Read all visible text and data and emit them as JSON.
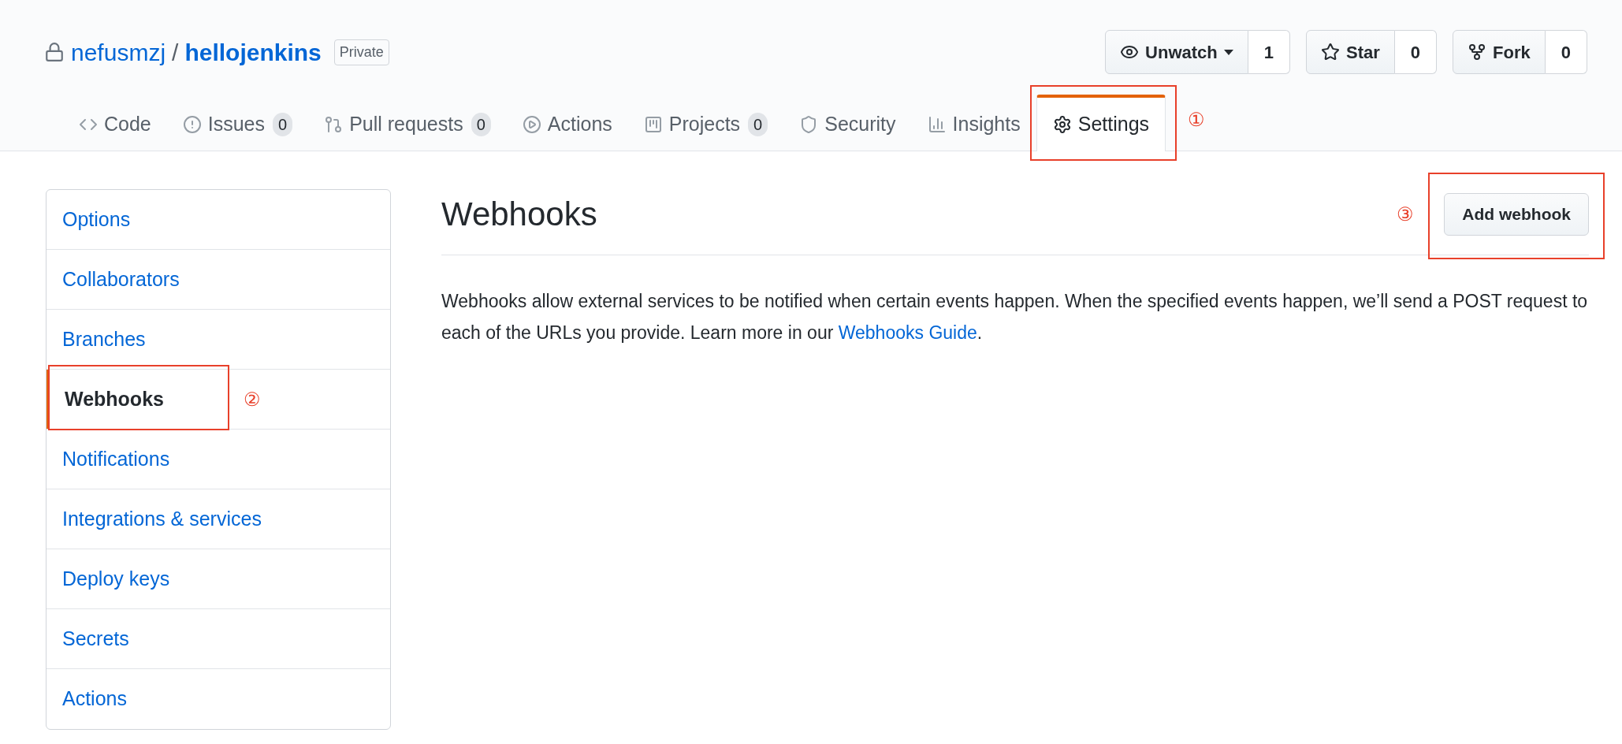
{
  "repo": {
    "owner": "nefusmzj",
    "separator": "/",
    "name": "hellojenkins",
    "badge": "Private"
  },
  "repo_actions": [
    {
      "kind": "watch",
      "label": "Unwatch",
      "count": "1",
      "has_menu": true
    },
    {
      "kind": "star",
      "label": "Star",
      "count": "0",
      "has_menu": false
    },
    {
      "kind": "fork",
      "label": "Fork",
      "count": "0",
      "has_menu": false
    }
  ],
  "tabs": [
    {
      "kind": "code",
      "label": "Code",
      "selected": false
    },
    {
      "kind": "issues",
      "label": "Issues",
      "count": "0",
      "selected": false
    },
    {
      "kind": "pulls",
      "label": "Pull requests",
      "count": "0",
      "selected": false
    },
    {
      "kind": "actions",
      "label": "Actions",
      "selected": false
    },
    {
      "kind": "projects",
      "label": "Projects",
      "count": "0",
      "selected": false
    },
    {
      "kind": "security",
      "label": "Security",
      "selected": false
    },
    {
      "kind": "insights",
      "label": "Insights",
      "selected": false
    },
    {
      "kind": "settings",
      "label": "Settings",
      "selected": true,
      "annotation": "①"
    }
  ],
  "sidebar": {
    "items": [
      {
        "label": "Options",
        "selected": false
      },
      {
        "label": "Collaborators",
        "selected": false
      },
      {
        "label": "Branches",
        "selected": false
      },
      {
        "label": "Webhooks",
        "selected": true,
        "annotation": "②"
      },
      {
        "label": "Notifications",
        "selected": false
      },
      {
        "label": "Integrations & services",
        "selected": false
      },
      {
        "label": "Deploy keys",
        "selected": false
      },
      {
        "label": "Secrets",
        "selected": false
      },
      {
        "label": "Actions",
        "selected": false
      }
    ]
  },
  "main": {
    "title": "Webhooks",
    "button": {
      "label": "Add webhook",
      "annotation": "③"
    },
    "description": "Webhooks allow external services to be notified when certain events happen. When the specified events happen, we’ll send a POST request to each of the URLs you provide. Learn more in our ",
    "link": "Webhooks Guide",
    "description_end": "."
  }
}
